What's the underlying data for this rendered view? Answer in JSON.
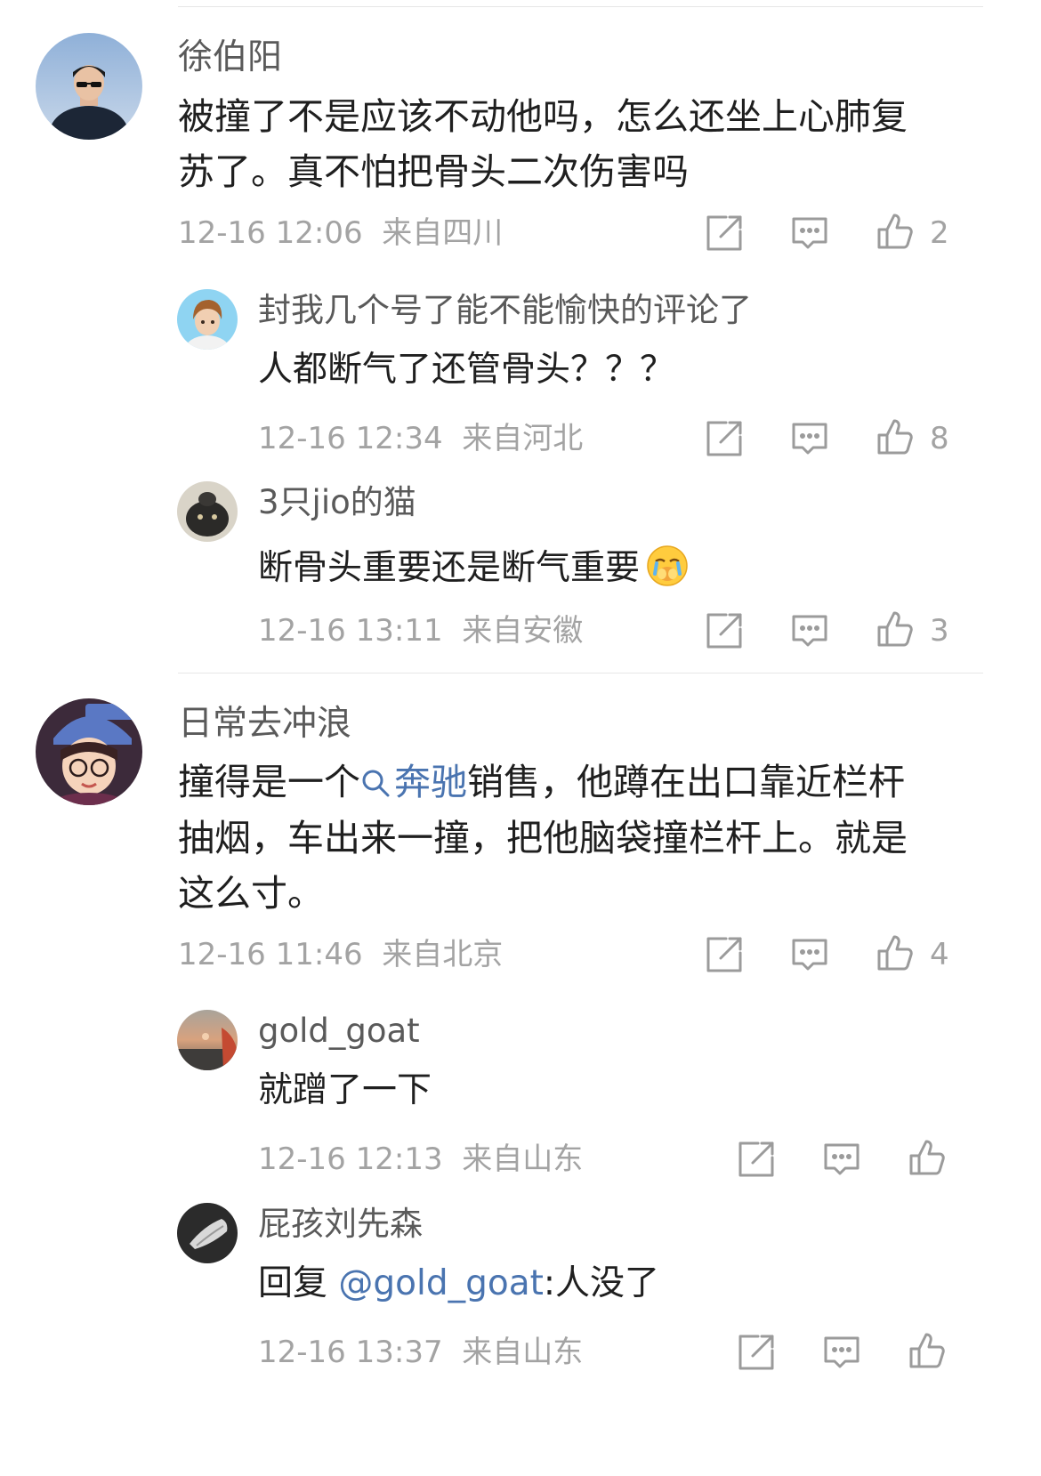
{
  "comments": [
    {
      "user": "徐伯阳",
      "text_line1": "被撞了不是应该不动他吗，怎么还坐上心肺复",
      "text_line2": "苏了。真不怕把骨头二次伤害吗",
      "time": "12-16 12:06",
      "location": "来自四川",
      "likes": "2",
      "replies": [
        {
          "user": "封我几个号了能不能愉快的评论了",
          "text": "人都断气了还管骨头？？？",
          "time": "12-16 12:34",
          "location": "来自河北",
          "likes": "8"
        },
        {
          "user": "3只jio的猫",
          "text": "断骨头重要还是断气重要",
          "time": "12-16 13:11",
          "location": "来自安徽",
          "likes": "3"
        }
      ]
    },
    {
      "user": "日常去冲浪",
      "text_line1_prefix": "撞得是一个",
      "text_line1_link": "奔驰",
      "text_line1_suffix": "销售，他蹲在出口靠近栏杆",
      "text_line2": "抽烟，车出来一撞，把他脑袋撞栏杆上。就是",
      "text_line3": "这么寸。",
      "time": "12-16 11:46",
      "location": "来自北京",
      "likes": "4",
      "replies": [
        {
          "user": "gold_goat",
          "text": "就蹭了一下",
          "time": "12-16 12:13",
          "location": "来自山东",
          "likes": ""
        },
        {
          "user": "屁孩刘先森",
          "text_prefix": "回复 ",
          "text_mention": "@gold_goat",
          "text_suffix": ":人没了",
          "time": "12-16 13:37",
          "location": "来自山东",
          "likes": ""
        }
      ]
    }
  ],
  "icons": {
    "share": "share-icon",
    "comment": "comment-icon",
    "like": "like-icon",
    "search": "search-icon",
    "emoji": "crying-emoji-icon"
  },
  "colors": {
    "link": "#4a74b0",
    "meta": "#a3a3a3",
    "name": "#5a5a5a"
  }
}
